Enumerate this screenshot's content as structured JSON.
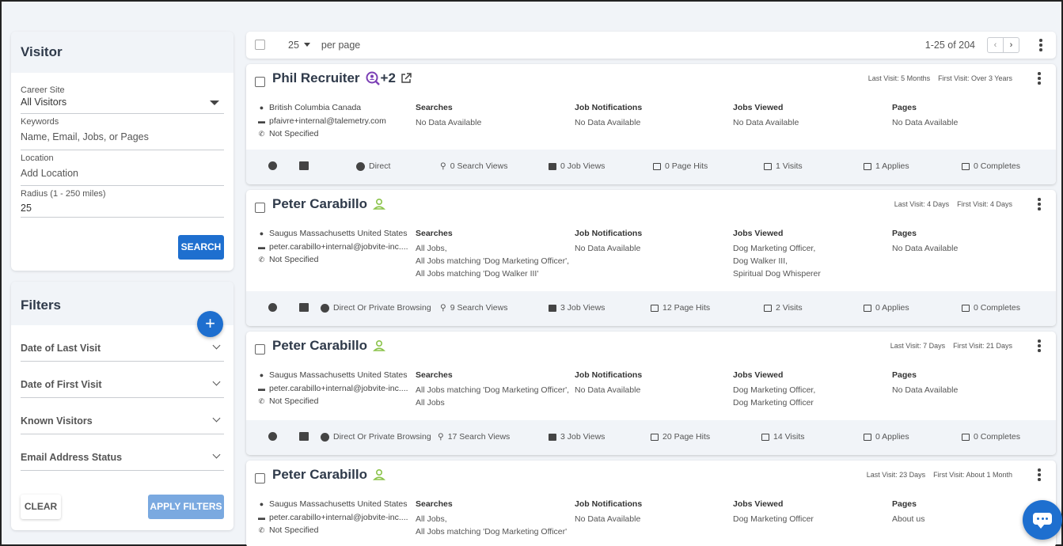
{
  "visitor": {
    "title": "Visitor",
    "career_site_label": "Career Site",
    "career_site_value": "All Visitors",
    "keywords_label": "Keywords",
    "keywords_placeholder": "Name, Email, Jobs, or Pages",
    "location_label": "Location",
    "location_placeholder": "Add Location",
    "radius_label": "Radius (1 - 250 miles)",
    "radius_value": "25",
    "search_button": "SEARCH"
  },
  "filters": {
    "title": "Filters",
    "add_symbol": "+",
    "items": [
      "Date of Last Visit",
      "Date of First Visit",
      "Known Visitors",
      "Email Address Status"
    ],
    "clear_button": "CLEAR",
    "apply_button": "APPLY FILTERS"
  },
  "toolbar": {
    "per_page_value": "25",
    "per_page_label": "per page",
    "range": "1-25 of 204",
    "prev": "‹",
    "next": "›"
  },
  "headers": {
    "searches": "Searches",
    "job_notifications": "Job Notifications",
    "jobs_viewed": "Jobs Viewed",
    "pages": "Pages"
  },
  "visitors": [
    {
      "name": "Phil Recruiter",
      "badge": "+2",
      "last_visit": "Last Visit: 5 Months",
      "first_visit": "First Visit: Over 3 Years",
      "location": "British Columbia Canada",
      "email": "pfaivre+internal@talemetry.com",
      "phone": "Not Specified",
      "searches": [
        "No Data Available"
      ],
      "job_notifications": [
        "No Data Available"
      ],
      "jobs_viewed": [
        "No Data Available"
      ],
      "pages": [
        "No Data Available"
      ],
      "source": "Direct",
      "search_views": "0 Search Views",
      "job_views": "0 Job Views",
      "page_hits": "0 Page Hits",
      "visits": "1 Visits",
      "applies": "1 Applies",
      "completes": "0 Completes"
    },
    {
      "name": "Peter Carabillo",
      "last_visit": "Last Visit: 4 Days",
      "first_visit": "First Visit: 4 Days",
      "location": "Saugus Massachusetts United States",
      "email": "peter.carabillo+internal@jobvite-inc....",
      "phone": "Not Specified",
      "searches": [
        "All Jobs,",
        "All Jobs matching 'Dog Marketing Officer',",
        "All Jobs matching 'Dog Walker III'"
      ],
      "job_notifications": [
        "No Data Available"
      ],
      "jobs_viewed": [
        "Dog Marketing Officer,",
        "Dog Walker III,",
        "Spiritual Dog Whisperer"
      ],
      "pages": [
        "No Data Available"
      ],
      "source": "Direct Or Private Browsing",
      "search_views": "9 Search Views",
      "job_views": "3 Job Views",
      "page_hits": "12 Page Hits",
      "visits": "2 Visits",
      "applies": "0 Applies",
      "completes": "0 Completes"
    },
    {
      "name": "Peter Carabillo",
      "last_visit": "Last Visit: 7 Days",
      "first_visit": "First Visit: 21 Days",
      "location": "Saugus Massachusetts United States",
      "email": "peter.carabillo+internal@jobvite-inc....",
      "phone": "Not Specified",
      "searches": [
        "All Jobs matching 'Dog Marketing Officer',",
        "All Jobs"
      ],
      "job_notifications": [
        "No Data Available"
      ],
      "jobs_viewed": [
        "Dog Marketing Officer,",
        "Dog Marketing Officer"
      ],
      "pages": [
        "No Data Available"
      ],
      "source": "Direct Or Private Browsing",
      "search_views": "17 Search Views",
      "job_views": "3 Job Views",
      "page_hits": "20 Page Hits",
      "visits": "14 Visits",
      "applies": "0 Applies",
      "completes": "0 Completes"
    },
    {
      "name": "Peter Carabillo",
      "last_visit": "Last Visit: 23 Days",
      "first_visit": "First Visit: About 1 Month",
      "location": "Saugus Massachusetts United States",
      "email": "peter.carabillo+internal@jobvite-inc....",
      "phone": "Not Specified",
      "searches": [
        "All Jobs,",
        "All Jobs matching 'Dog Marketing Officer'"
      ],
      "job_notifications": [
        "No Data Available"
      ],
      "jobs_viewed": [
        "Dog Marketing Officer"
      ],
      "pages": [
        "About us"
      ]
    }
  ],
  "icons": {
    "accent_blue": "#1e6fcf",
    "known_user_color": "#8bc34a",
    "recruiter_color": "#7b3fb5"
  }
}
